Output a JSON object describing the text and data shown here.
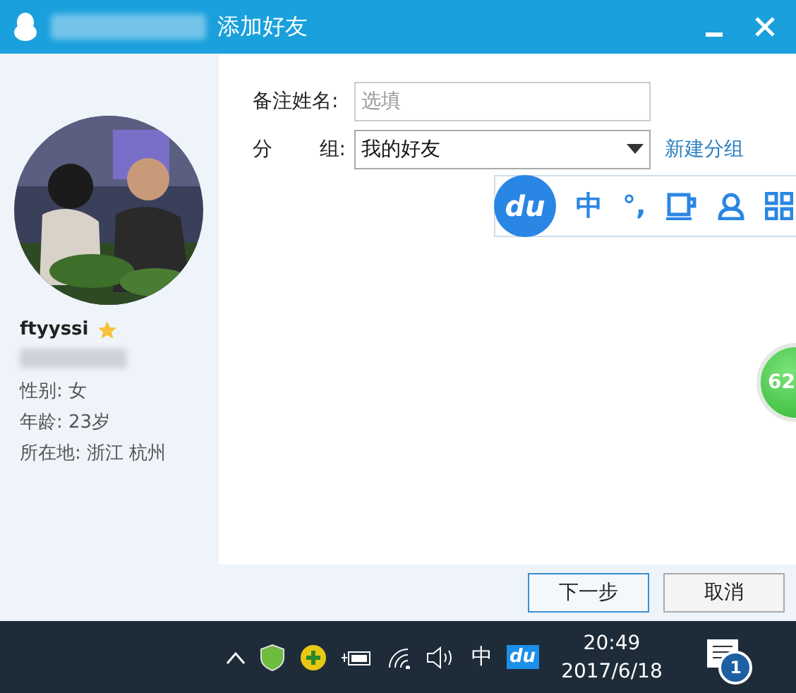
{
  "window": {
    "title": "添加好友"
  },
  "profile": {
    "username": "ftyyssi",
    "starred": true,
    "details": [
      "性别: 女",
      "年龄: 23岁",
      "所在地: 浙江  杭州"
    ]
  },
  "form": {
    "remark_label": "备注姓名:",
    "remark_placeholder": "选填",
    "group_label_start": "分",
    "group_label_end": "组:",
    "group_value": "我的好友",
    "new_group_link": "新建分组"
  },
  "ime_toolbar": {
    "logo": "du",
    "mode": "中",
    "punctuation": "°,"
  },
  "floating_ball": {
    "value": "62"
  },
  "buttons": [
    {
      "label": "下一步",
      "primary": true
    },
    {
      "label": "取消",
      "primary": false
    }
  ],
  "taskbar": {
    "ime": "中",
    "ime_logo": "du",
    "time": "20:49",
    "date": "2017/6/18",
    "notifications": "1"
  }
}
